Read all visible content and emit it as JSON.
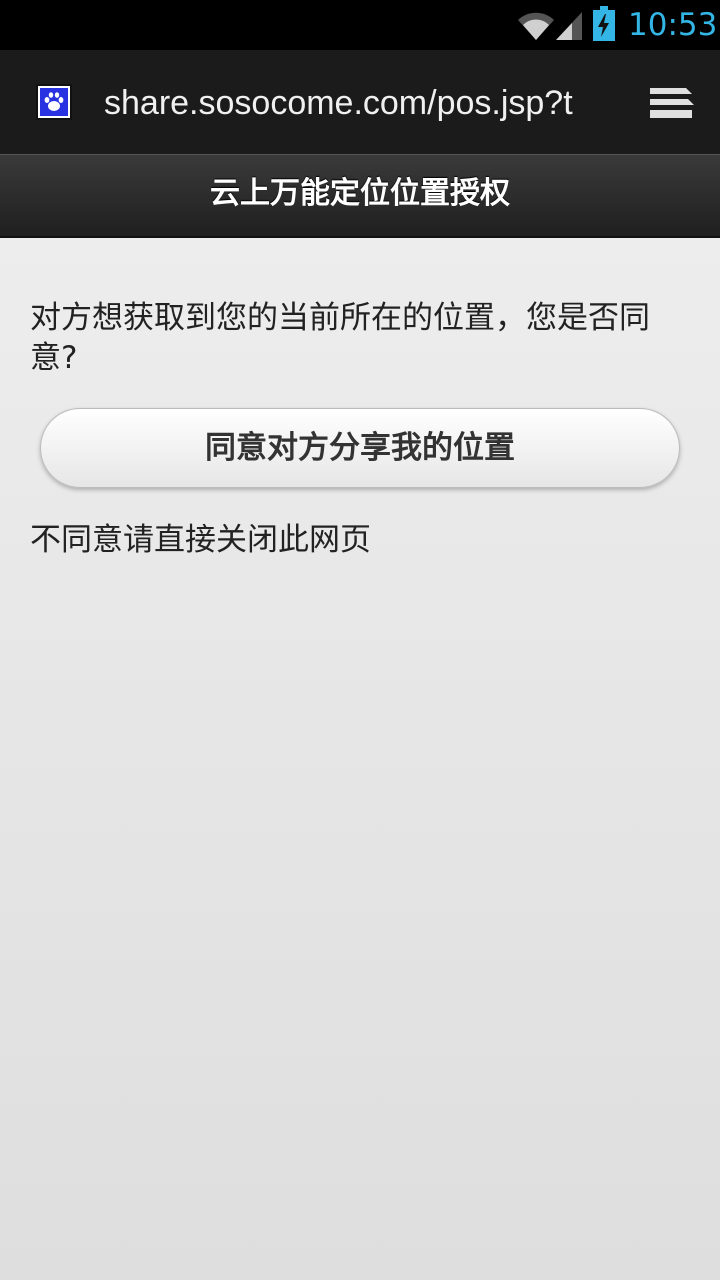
{
  "status_bar": {
    "time": "10:53",
    "icons": [
      "wifi-icon",
      "signal-icon",
      "battery-charging-icon"
    ],
    "clock_color": "#33b5e5"
  },
  "browser": {
    "url": "share.sosocome.com/pos.jsp?t",
    "favicon": "baidu-paw-icon",
    "menu_icon": "tabs-stack-icon"
  },
  "page": {
    "title": "云上万能定位位置授权",
    "question": "对方想获取到您的当前所在的位置，您是否同意?",
    "agree_button": "同意对方分享我的位置",
    "decline_text": "不同意请直接关闭此网页"
  }
}
